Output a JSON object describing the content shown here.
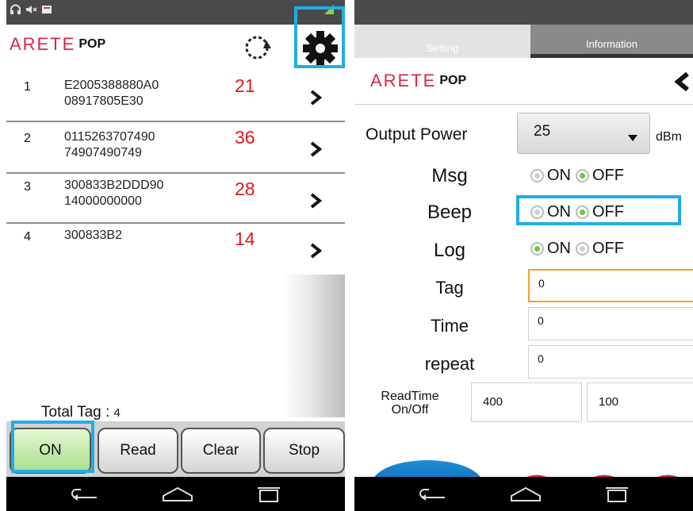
{
  "colors": {
    "accent_highlight": "#1eaee8",
    "count_red": "#e01818",
    "brand_red": "#d8264a",
    "radio_checked": "#66cc33",
    "focus_orange": "#f0a030"
  },
  "brand": {
    "logo_text": "ARETE",
    "logo_suffix": "POP"
  },
  "left": {
    "tag_rows": [
      {
        "index": "1",
        "epc_line1": "E2005388880A0",
        "epc_line2": "08917805E30",
        "count": "21"
      },
      {
        "index": "2",
        "epc_line1": "0115263707490",
        "epc_line2": "74907490749",
        "count": "36"
      },
      {
        "index": "3",
        "epc_line1": "300833B2DDD90",
        "epc_line2": "14000000000",
        "count": "28"
      },
      {
        "index": "4",
        "epc_line1": "300833B2",
        "epc_line2": "",
        "count": "14"
      }
    ],
    "total_label": "Total Tag :",
    "total_value": "4",
    "buttons": {
      "on": "ON",
      "read": "Read",
      "clear": "Clear",
      "stop": "Stop"
    }
  },
  "right": {
    "tabs": {
      "setting": "Setting",
      "information": "Information"
    },
    "output_power": {
      "label": "Output Power",
      "value": "25",
      "unit": "dBm"
    },
    "radio_on_label": "ON",
    "radio_off_label": "OFF",
    "msg": {
      "label": "Msg",
      "selected": "OFF"
    },
    "beep": {
      "label": "Beep",
      "selected": "OFF"
    },
    "log": {
      "label": "Log",
      "selected": "ON"
    },
    "tag": {
      "label": "Tag",
      "value": "0"
    },
    "time": {
      "label": "Time",
      "value": "0"
    },
    "repeat": {
      "label": "repeat",
      "value": "0"
    },
    "readtime": {
      "label_line1": "ReadTime",
      "label_line2": "On/Off",
      "on_value": "400",
      "off_value": "100"
    }
  },
  "icons": {
    "status": [
      "headphones-icon",
      "muted-speaker-icon",
      "notification-icon",
      "signal-icon"
    ],
    "header": [
      "sync-icon",
      "gear-icon",
      "chevron-left-icon"
    ],
    "nav": [
      "back-icon",
      "home-icon",
      "recents-icon"
    ]
  }
}
